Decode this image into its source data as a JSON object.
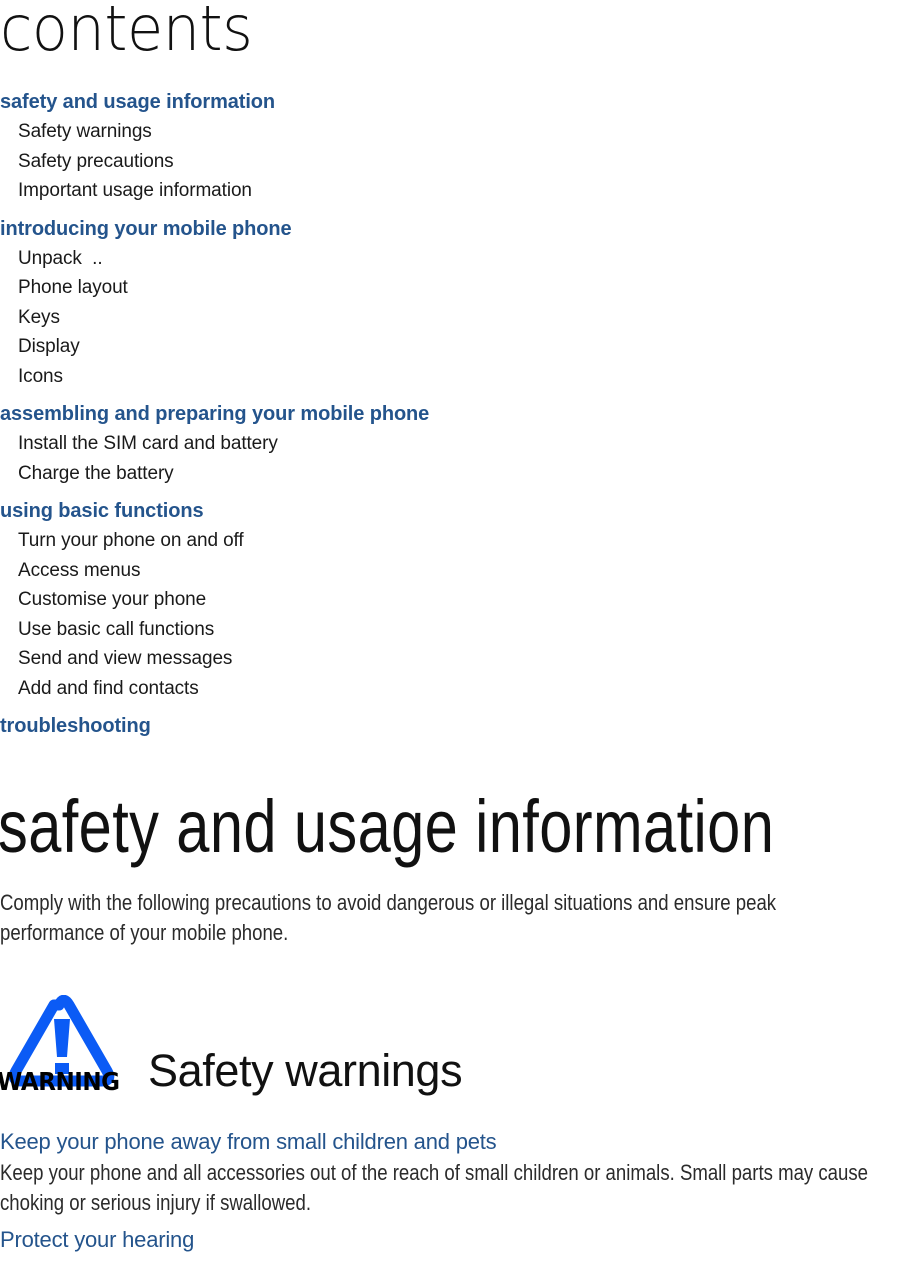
{
  "document": {
    "contents_title": "contents",
    "chapter_title": "safety and usage information",
    "intro_paragraph": "Comply with the following precautions to avoid dangerous or illegal situations and ensure peak performance of your mobile phone."
  },
  "toc": {
    "sections": [
      {
        "heading": "safety and usage information",
        "items": [
          "Safety warnings",
          "Safety precautions",
          "Important usage information"
        ]
      },
      {
        "heading": "introducing your mobile phone",
        "items": [
          "Unpack  ..",
          "Phone layout",
          "Keys",
          "Display",
          "Icons"
        ]
      },
      {
        "heading": "assembling and preparing your mobile phone",
        "items": [
          "Install the SIM card and battery",
          "Charge the battery"
        ]
      },
      {
        "heading": "using basic functions",
        "items": [
          "Turn your phone on and off",
          "Access menus",
          "Customise your phone",
          "Use basic call functions",
          "Send and view messages",
          "Add and find contacts"
        ]
      },
      {
        "heading": "troubleshooting",
        "items": []
      }
    ]
  },
  "warning_block": {
    "icon_label": "WARNING",
    "icon_name": "warning-triangle-icon",
    "heading": "Safety warnings"
  },
  "subsections": [
    {
      "heading": "Keep your phone away from small children and pets",
      "body": "Keep your phone and all accessories out of the reach of small children or animals. Small parts may cause choking or serious injury if swallowed."
    },
    {
      "heading": "Protect your hearing",
      "body": ""
    }
  ],
  "colors": {
    "accent_blue": "#24548c",
    "warning_blue": "#0b5bf5",
    "body_text": "#2b2b2b",
    "page_background": "#ffffff"
  }
}
